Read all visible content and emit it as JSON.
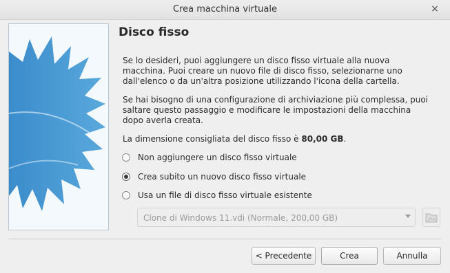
{
  "window": {
    "title": "Crea macchina virtuale",
    "close_glyph": "×"
  },
  "page": {
    "title": "Disco fisso",
    "para1": "Se lo desideri, puoi aggiungere un disco fisso virtuale alla nuova macchina. Puoi creare un nuovo file di disco fisso, selezionarne uno dall'elenco o da un'altra posizione utilizzando l'icona della cartella.",
    "para2": "Se hai bisogno di una configurazione di archiviazione più complessa, puoi saltare questo passaggio e modificare le impostazioni della macchina dopo averla creata.",
    "size_prefix": "La dimensione consigliata del disco fisso è ",
    "size_value": "80,00 GB",
    "size_suffix": "."
  },
  "options": [
    {
      "label": "Non aggiungere un disco fisso virtuale",
      "checked": false
    },
    {
      "label": "Crea subito un nuovo disco fisso virtuale",
      "checked": true
    },
    {
      "label": "Usa un file di disco fisso virtuale esistente",
      "checked": false
    }
  ],
  "existing_disk": {
    "selected": "Clone di Windows 11.vdi (Normale, 200,00 GB)",
    "enabled": false
  },
  "buttons": {
    "back": "< Precedente",
    "create": "Crea",
    "cancel": "Annulla"
  },
  "icons": {
    "close": "close-icon",
    "combo": "chevron-down-icon",
    "folder": "folder-icon",
    "banner": "hard-disk-banner"
  },
  "colors": {
    "banner_blue": "#3f93cf",
    "banner_bg": "#f4f9fd"
  }
}
